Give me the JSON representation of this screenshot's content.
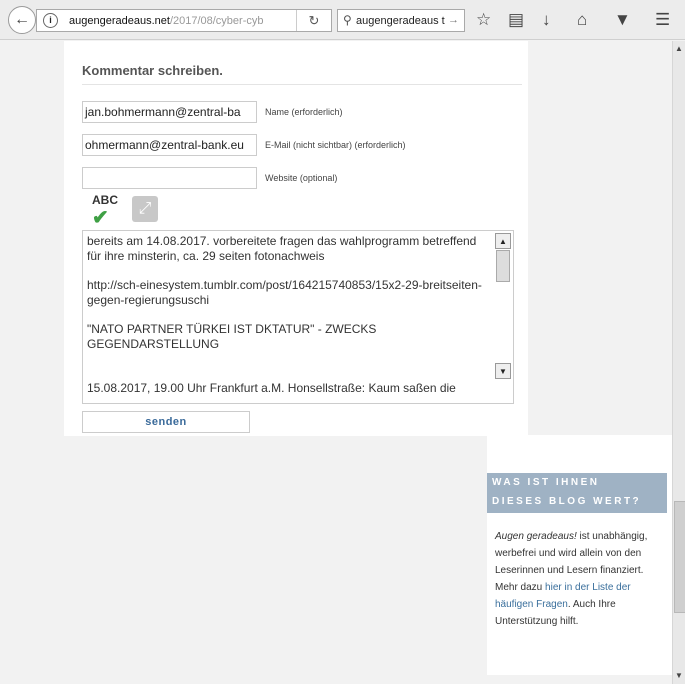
{
  "browser": {
    "url_host": "augengeradeaus.net",
    "url_path": "/2017/08/cyber-cyb",
    "search_text": "augengeradeaus t"
  },
  "comment_form": {
    "heading": "Kommentar schreiben.",
    "name_value": "jan.bohmermann@zentral-ba",
    "name_label": "Name (erforderlich)",
    "email_value": "ohmermann@zentral-bank.eu",
    "email_label": "E-Mail (nicht sichtbar) (erforderlich)",
    "website_value": "",
    "website_label": "Website (optional)",
    "spellcheck_label": "ABC",
    "comment_lines": [
      "bereits am 14.08.2017. vorbereitete fragen das wahlprogramm betreffend für ihre minsterin, ca. 29 seiten fotonachweis",
      "http://sch-einesystem.tumblr.com/post/164215740853/15x2-29-breitseiten-gegen-regierungsuschi",
      "\"NATO PARTNER TÜRKEI IST DKTATUR\" - ZWECKS GEGENDARSTELLUNG",
      "",
      "15.08.2017, 19.00 Uhr Frankfurt a.M. Honsellstraße: Kaum saßen die"
    ],
    "send_label": "senden"
  },
  "sidebar": {
    "banner_line1": "WAS IST IHNEN",
    "banner_line2": "DIESES BLOG WERT?",
    "text_italic": "Augen geradeaus!",
    "text_1": " ist unabhängig, werbefrei und wird allein von den Leserinnen und Lesern finanziert. ",
    "text_link_prefix": "Mehr dazu ",
    "text_link": "hier in der Liste der häufigen Fragen",
    "text_2": ". Auch Ihre Unterstützung hilft."
  },
  "colors": {
    "banner_bg": "#9fb2c4",
    "link": "#3a6f9c",
    "check": "#3fa045"
  }
}
